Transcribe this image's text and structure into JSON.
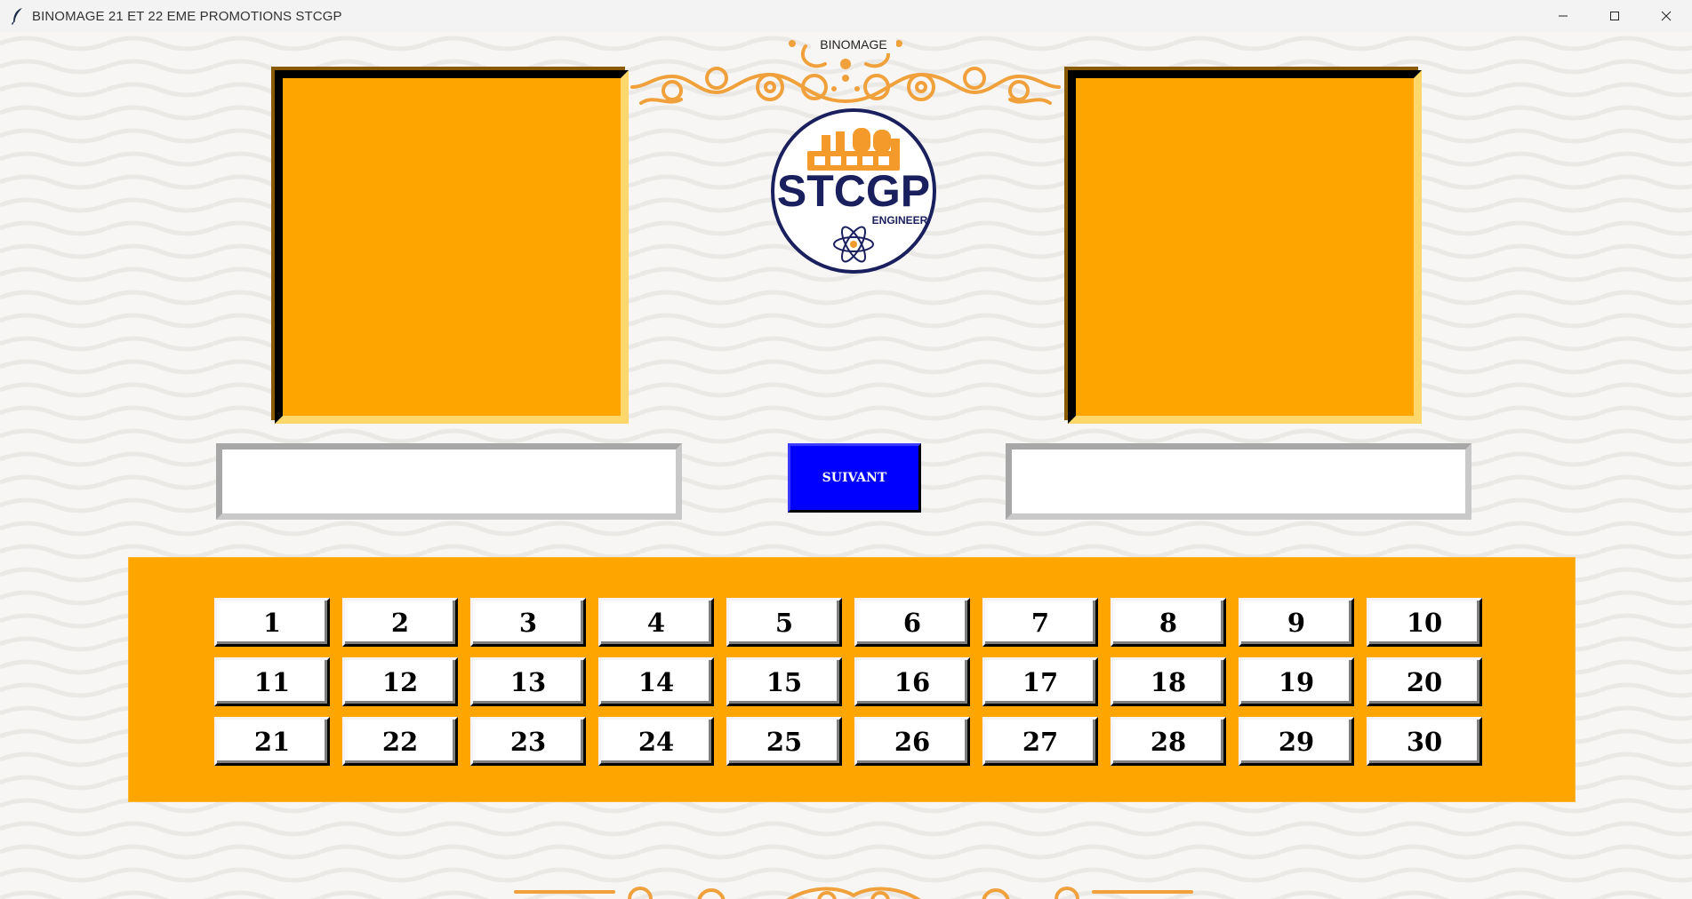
{
  "window": {
    "title": "BINOMAGE 21 ET 22 EME PROMOTIONS STCGP",
    "icon": "feather-icon",
    "controls": [
      "minimize-icon",
      "maximize-icon",
      "close-icon"
    ]
  },
  "header": {
    "label": "BINOMAGE"
  },
  "logo": {
    "text": "STCGP",
    "subtext": "ENGINEER",
    "colors": {
      "navy": "#1a1f5e",
      "orange": "#f39a2b"
    }
  },
  "form": {
    "left_name_value": "",
    "right_name_value": "",
    "next_label": "SUIVANT"
  },
  "numbers": [
    "1",
    "2",
    "3",
    "4",
    "5",
    "6",
    "7",
    "8",
    "9",
    "10",
    "11",
    "12",
    "13",
    "14",
    "15",
    "16",
    "17",
    "18",
    "19",
    "20",
    "21",
    "22",
    "23",
    "24",
    "25",
    "26",
    "27",
    "28",
    "29",
    "30"
  ],
  "colors": {
    "accent": "#ffa500",
    "button_blue": "#0000ff",
    "ornament": "#f0a13c"
  }
}
